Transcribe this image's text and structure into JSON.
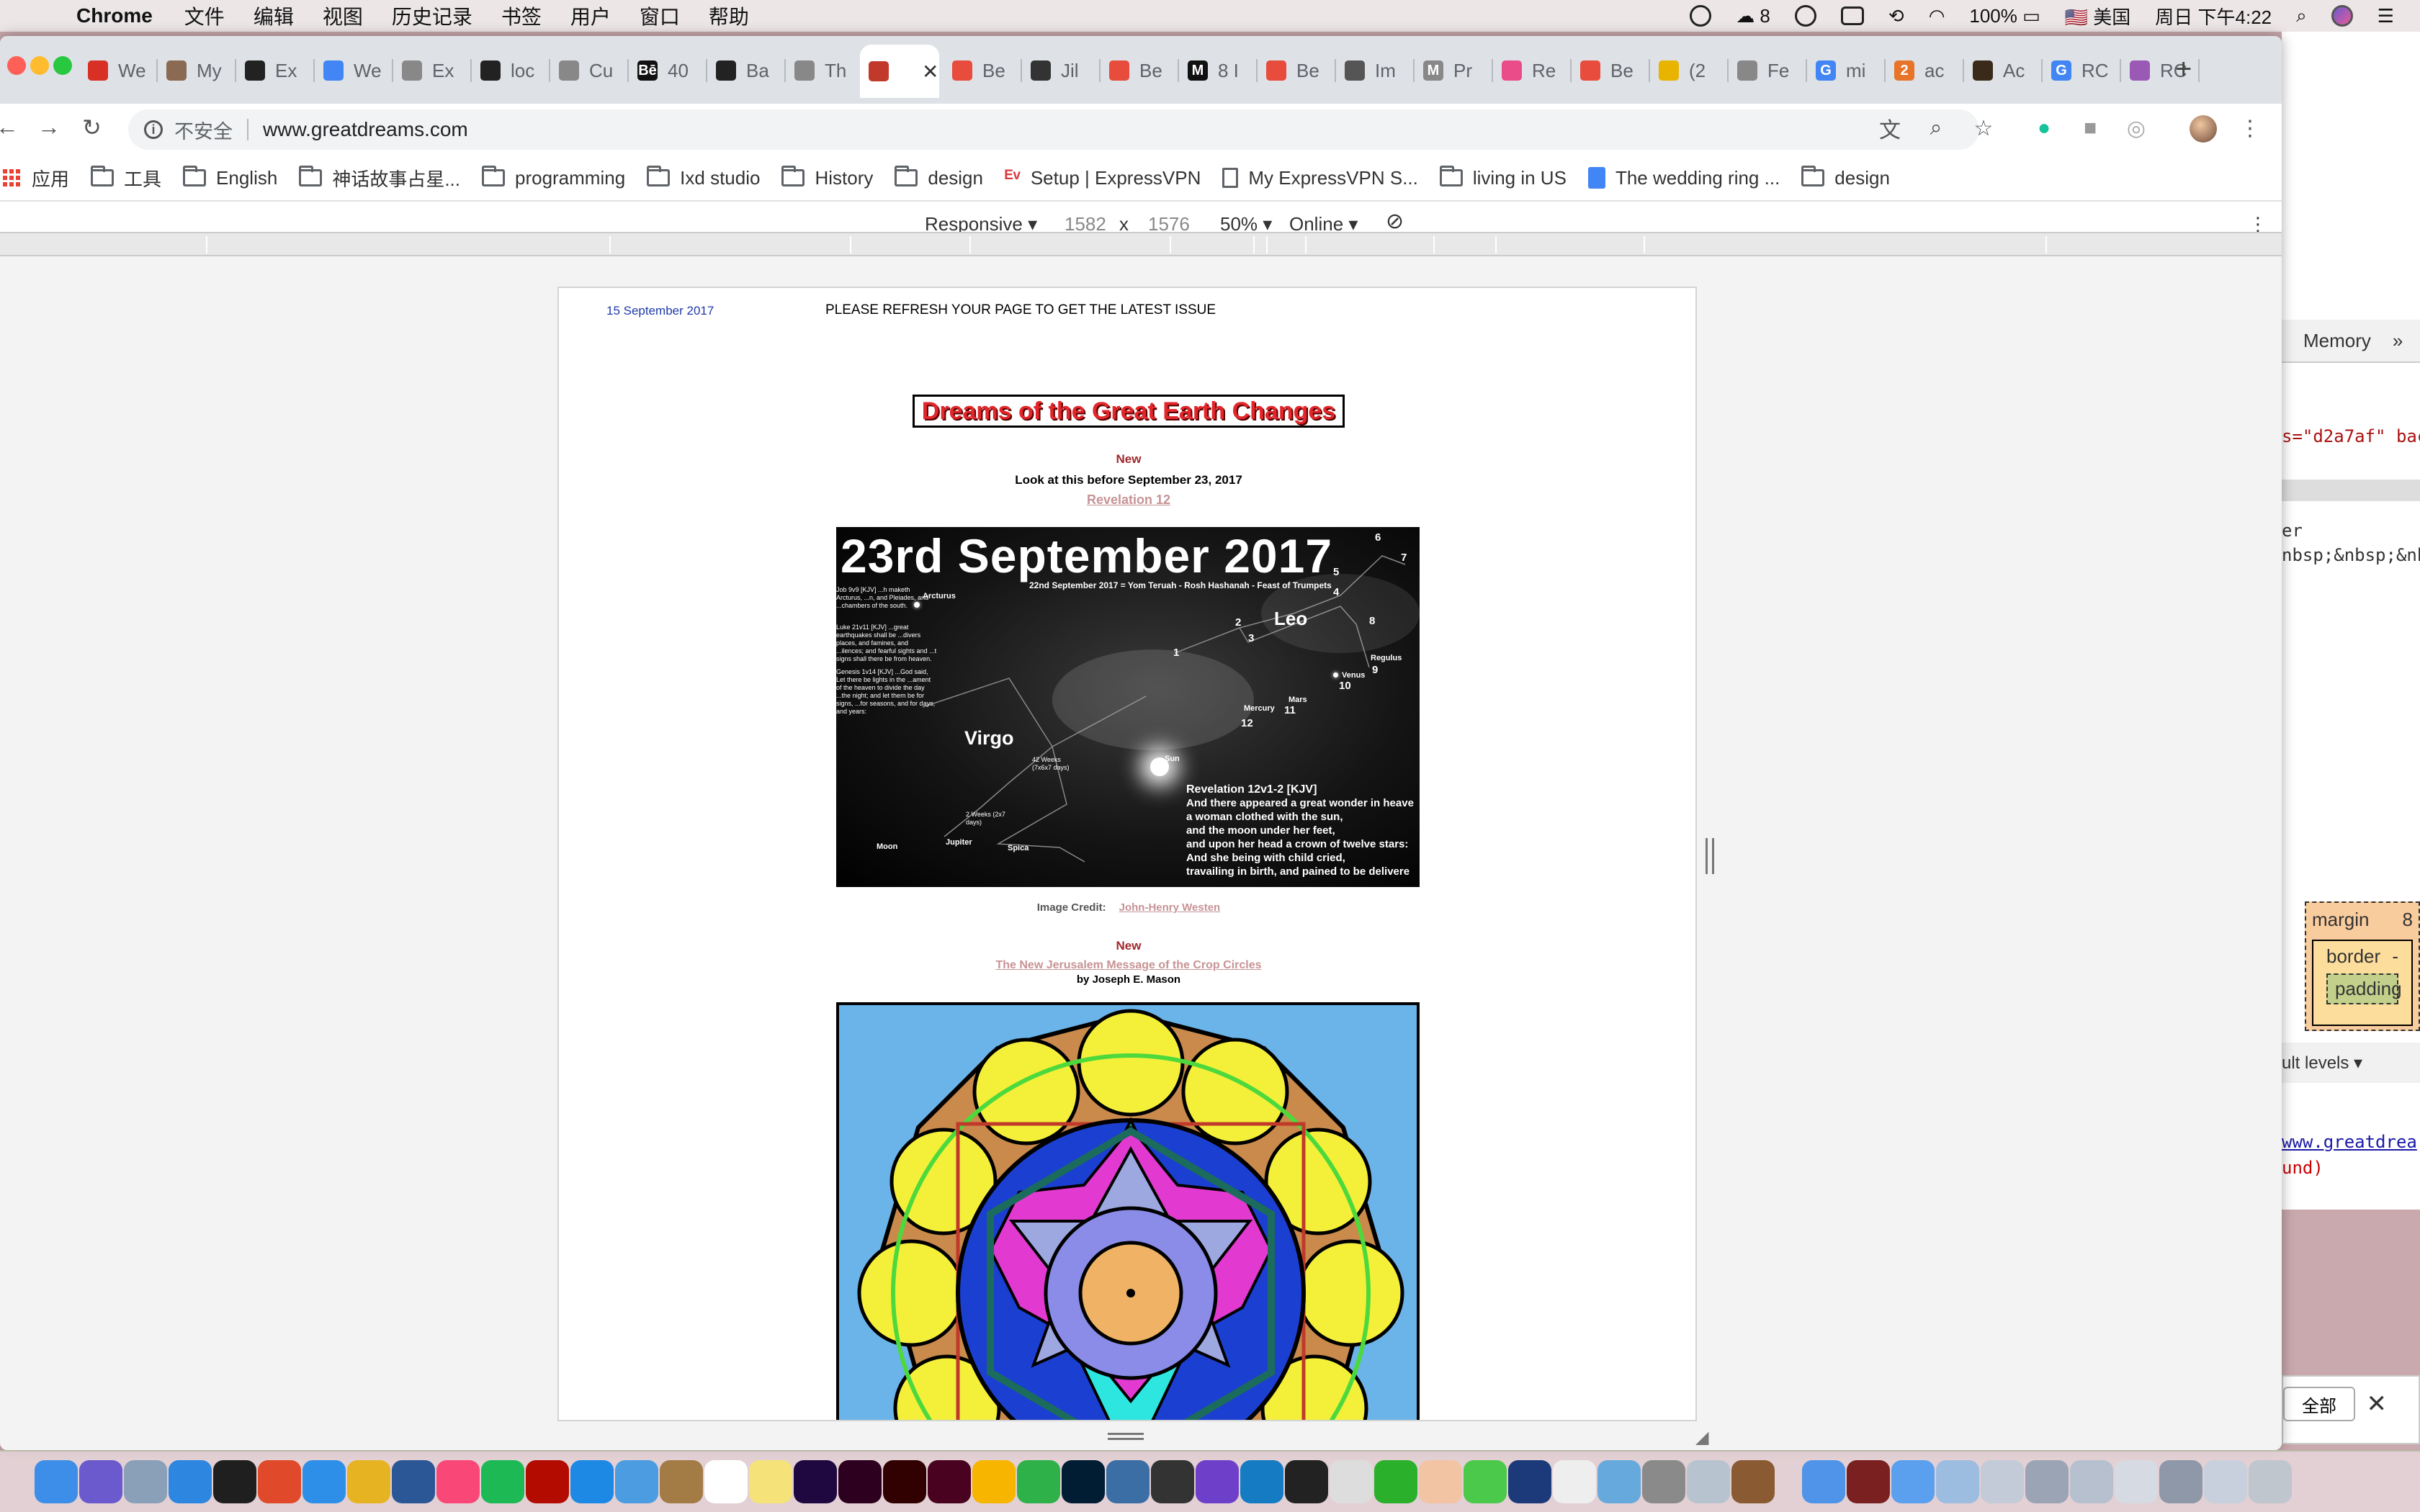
{
  "menubar": {
    "app_name": "Chrome",
    "menus": [
      "文件",
      "编辑",
      "视图",
      "历史记录",
      "书签",
      "用户",
      "窗口",
      "帮助"
    ],
    "wechat_count": "8",
    "battery": "100%",
    "input_method": "美国",
    "clock": "周日 下午4:22"
  },
  "tabs": [
    {
      "label": "We",
      "icon": "gmail-icon",
      "color": "#d93025"
    },
    {
      "label": "My",
      "icon": "image-icon",
      "color": "#8a6a52"
    },
    {
      "label": "Ex",
      "icon": "github-icon",
      "color": "#222222"
    },
    {
      "label": "We",
      "icon": "docs-icon",
      "color": "#4285f4"
    },
    {
      "label": "Ex",
      "icon": "page-icon",
      "color": "#888888"
    },
    {
      "label": "loc",
      "icon": "github-icon",
      "color": "#222222"
    },
    {
      "label": "Cu",
      "icon": "page-icon",
      "color": "#888888"
    },
    {
      "label": "40",
      "icon": "behance-icon",
      "color": "#111111",
      "fav_text": "Bē"
    },
    {
      "label": "Ba",
      "icon": "search-icon",
      "color": "#222222"
    },
    {
      "label": "Th",
      "icon": "page-icon",
      "color": "#888888"
    },
    {
      "label": "",
      "icon": "greatdreams-icon",
      "color": "#c0392b",
      "active": true
    },
    {
      "label": "Be",
      "icon": "record-icon",
      "color": "#e74c3c"
    },
    {
      "label": "Jil",
      "icon": "stripes-icon",
      "color": "#333333"
    },
    {
      "label": "Be",
      "icon": "record-icon",
      "color": "#e74c3c"
    },
    {
      "label": "8 I",
      "icon": "medium-icon",
      "color": "#111111",
      "fav_text": "M"
    },
    {
      "label": "Be",
      "icon": "record-icon",
      "color": "#e74c3c"
    },
    {
      "label": "Im",
      "icon": "hand-icon",
      "color": "#555555"
    },
    {
      "label": "Pr",
      "icon": "m-circle-icon",
      "color": "#888888",
      "fav_text": "M"
    },
    {
      "label": "Re",
      "icon": "dribbble-icon",
      "color": "#ea4c89"
    },
    {
      "label": "Be",
      "icon": "record-icon",
      "color": "#e74c3c"
    },
    {
      "label": "(2",
      "icon": "yellow-bars-icon",
      "color": "#e8b400"
    },
    {
      "label": "Fe",
      "icon": "page-icon",
      "color": "#888888"
    },
    {
      "label": "mi",
      "icon": "google-icon",
      "color": "#4285f4",
      "fav_text": "G"
    },
    {
      "label": "ac",
      "icon": "two-icon",
      "color": "#e8742a",
      "fav_text": "2"
    },
    {
      "label": "Ac",
      "icon": "dark-square-icon",
      "color": "#3a2a1a"
    },
    {
      "label": "RC",
      "icon": "google-icon",
      "color": "#4285f4",
      "fav_text": "G"
    },
    {
      "label": "RC",
      "icon": "chrome-color-icon",
      "color": "#9b59b6"
    }
  ],
  "toolbar": {
    "insecure_label": "不安全",
    "url": "www.greatdreams.com"
  },
  "bookmarks": [
    {
      "label": "应用",
      "icon": "apps-icon"
    },
    {
      "label": "工具",
      "icon": "folder-icon"
    },
    {
      "label": "English",
      "icon": "folder-icon"
    },
    {
      "label": "神话故事占星...",
      "icon": "folder-icon"
    },
    {
      "label": "programming",
      "icon": "folder-icon"
    },
    {
      "label": "Ixd studio",
      "icon": "folder-icon"
    },
    {
      "label": "History",
      "icon": "folder-icon"
    },
    {
      "label": "design",
      "icon": "folder-icon"
    },
    {
      "label": "Setup | ExpressVPN",
      "icon": "expressvpn-icon"
    },
    {
      "label": "My ExpressVPN S...",
      "icon": "page-icon"
    },
    {
      "label": "living in US",
      "icon": "folder-icon"
    },
    {
      "label": "The wedding ring ...",
      "icon": "gdoc-icon"
    },
    {
      "label": "design",
      "icon": "folder-icon"
    }
  ],
  "device_toolbar": {
    "mode": "Responsive ▾",
    "width": "1582",
    "times": "x",
    "height": "1576",
    "zoom": "50% ▾",
    "network": "Online ▾"
  },
  "page": {
    "date": "15 September 2017",
    "refresh_notice": "PLEASE REFRESH YOUR PAGE TO GET THE LATEST ISSUE",
    "main_title": "Dreams of the Great Earth Changes",
    "section1": {
      "new_label": "New",
      "subtitle": "Look at this before September 23, 2017",
      "link": "Revelation 12"
    },
    "sky_image": {
      "headline": "23rd September 2017",
      "subline": "22nd September 2017 = Yom Teruah - Rosh Hashanah - Feast of Trumpets",
      "labels": {
        "leo": "Leo",
        "virgo": "Virgo",
        "arcturus": "Arcturus",
        "regulus": "Regulus",
        "venus": "Venus",
        "mars": "Mars",
        "mercury": "Mercury",
        "sun": "Sun",
        "moon": "Moon",
        "jupiter": "Jupiter",
        "spica": "Spica"
      },
      "star_numbers": [
        "1",
        "2",
        "3",
        "4",
        "5",
        "6",
        "7",
        "8",
        "9",
        "10",
        "11",
        "12"
      ],
      "notes": [
        "Job 9v9 [KJV] ...h maketh Arcturus, ...n, and Pleiades, and ...chambers of the south.",
        "Luke 21v11 [KJV] ...great earthquakes shall be ...divers places, and famines, and ...ilences; and fearful sights and ...t signs shall there be from heaven.",
        "Genesis 1v14 [KJV] ...God said, Let there be lights in the ...ament of the heaven to divide the day ...the night; and let them be for signs, ...for seasons, and for days, and years:"
      ],
      "weeks_note": "42 Weeks (7x6x7 days)",
      "weeks_note2": "2 Weeks (2x7 days)",
      "revelation_title": "Revelation 12v1-2 [KJV]",
      "revelation_lines": [
        "And there appeared a great wonder in heave",
        "a woman clothed with the sun,",
        "and the moon under her feet,",
        "and upon her head a crown of twelve stars:",
        "And she being with child cried,",
        "travailing in birth, and pained to be delivere"
      ]
    },
    "credit_label": "Image Credit:",
    "credit_link": "John-Henry Westen",
    "section2": {
      "new_label": "New",
      "link": "The New Jerusalem Message of the Crop Circles",
      "byline": "by Joseph E. Mason"
    }
  },
  "devtools": {
    "tab_memory": "Memory",
    "code_line1": "s=\"d2a7af\" bac",
    "code_line2": "er",
    "code_line3": "nbsp;&nbsp;&nb",
    "box_margin": "margin",
    "box_margin_val": "8",
    "box_border": "border",
    "box_border_val": "-",
    "box_padding": "padding",
    "levels": "ult levels ▾",
    "console_link": "www.greatdrea",
    "console_err": "und)"
  },
  "popup": {
    "button": "全部"
  },
  "colors": {
    "title_red": "#e2262a",
    "link_pink": "#c79395",
    "new_red": "#a0282c"
  }
}
